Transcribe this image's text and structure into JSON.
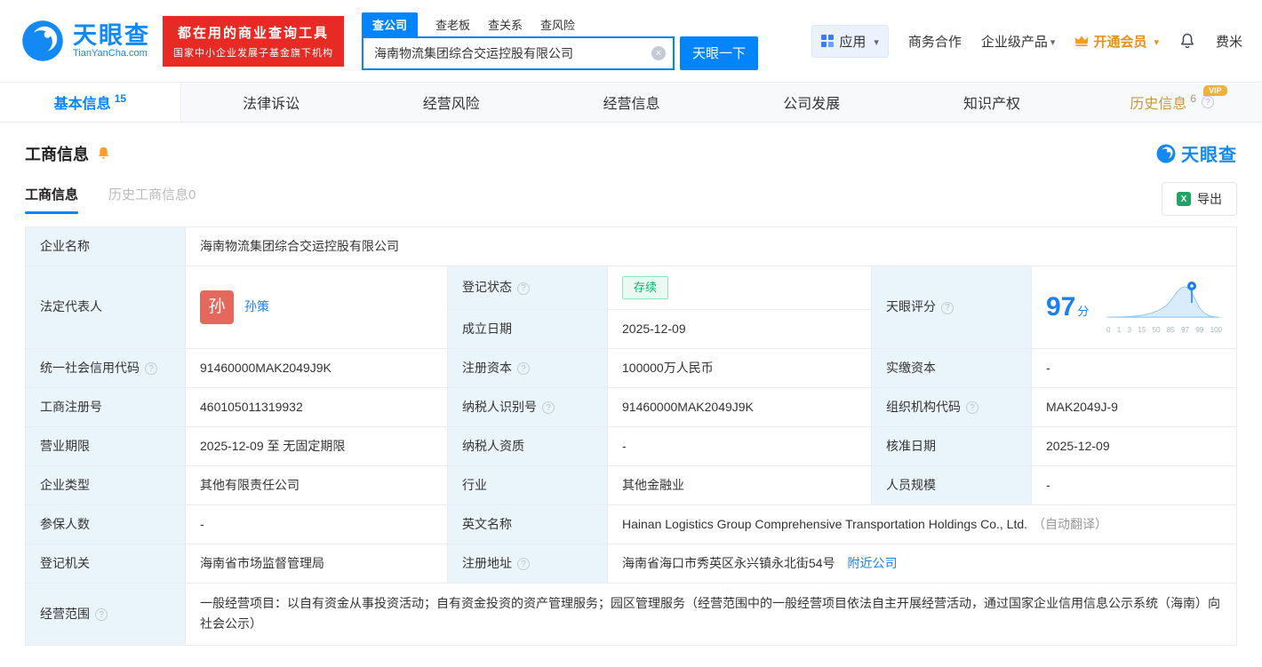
{
  "colors": {
    "brand_blue": "#0084FF",
    "link_blue": "#1B7FF2",
    "promo_red": "#E72A24",
    "vip_gold": "#F0B03C",
    "member_orange": "#E98F17",
    "status_green": "#00B578",
    "label_bg": "#EAF4FB",
    "avatar_red": "#E4695C"
  },
  "header": {
    "logo": {
      "title": "天眼查",
      "subtitle": "TianYanCha.com"
    },
    "promo": {
      "line1": "都在用的商业查询工具",
      "line2": "国家中小企业发展子基金旗下机构"
    },
    "search": {
      "tabs": [
        {
          "label": "查公司"
        },
        {
          "label": "查老板"
        },
        {
          "label": "查关系"
        },
        {
          "label": "查风险"
        }
      ],
      "value": "海南物流集团综合交运控股有限公司",
      "button": "天眼一下"
    },
    "right": {
      "apps": "应用",
      "links": [
        "商务合作",
        "企业级产品"
      ],
      "vip": "开通会员",
      "user": "费米"
    }
  },
  "nav": {
    "tabs": [
      {
        "label": "基本信息",
        "count": "15"
      },
      {
        "label": "法律诉讼"
      },
      {
        "label": "经营风险"
      },
      {
        "label": "经营信息"
      },
      {
        "label": "公司发展"
      },
      {
        "label": "知识产权"
      },
      {
        "label": "历史信息",
        "count": "6",
        "vip": "VIP"
      }
    ]
  },
  "section": {
    "title": "工商信息",
    "watermark": "天眼查"
  },
  "subtabs": {
    "active": "工商信息",
    "inactive": "历史工商信息0",
    "export": "导出"
  },
  "table": {
    "company_name_label": "企业名称",
    "company_name": "海南物流集团综合交运控股有限公司",
    "legal_rep_label": "法定代表人",
    "legal_rep_avatar": "孙",
    "legal_rep_name": "孙策",
    "reg_status_label": "登记状态",
    "reg_status": "存续",
    "established_label": "成立日期",
    "established": "2025-12-09",
    "score_label": "天眼评分",
    "score": "97",
    "score_unit": "分",
    "score_ticks": [
      "0",
      "1",
      "3",
      "15",
      "50",
      "85",
      "97",
      "99",
      "100"
    ],
    "uscc_label": "统一社会信用代码",
    "uscc": "91460000MAK2049J9K",
    "reg_capital_label": "注册资本",
    "reg_capital": "100000万人民币",
    "paid_capital_label": "实缴资本",
    "paid_capital": "-",
    "reg_number_label": "工商注册号",
    "reg_number": "460105011319932",
    "taxpayer_id_label": "纳税人识别号",
    "taxpayer_id": "91460000MAK2049J9K",
    "org_code_label": "组织机构代码",
    "org_code": "MAK2049J-9",
    "business_term_label": "营业期限",
    "business_term": "2025-12-09 至 无固定期限",
    "taxpayer_qual_label": "纳税人资质",
    "taxpayer_qual": "-",
    "approval_date_label": "核准日期",
    "approval_date": "2025-12-09",
    "company_type_label": "企业类型",
    "company_type": "其他有限责任公司",
    "industry_label": "行业",
    "industry": "其他金融业",
    "staff_size_label": "人员规模",
    "staff_size": "-",
    "insured_label": "参保人数",
    "insured": "-",
    "english_name_label": "英文名称",
    "english_name": "Hainan Logistics Group Comprehensive Transportation Holdings Co., Ltd.",
    "english_name_note": "（自动翻译）",
    "reg_authority_label": "登记机关",
    "reg_authority": "海南省市场监督管理局",
    "address_label": "注册地址",
    "address": "海南省海口市秀英区永兴镇永北街54号",
    "address_link": "附近公司",
    "business_scope_label": "经营范围",
    "business_scope": "一般经营项目：以自有资金从事投资活动；自有资金投资的资产管理服务；园区管理服务（经营范围中的一般经营项目依法自主开展经营活动，通过国家企业信用信息公示系统（海南）向社会公示）"
  }
}
